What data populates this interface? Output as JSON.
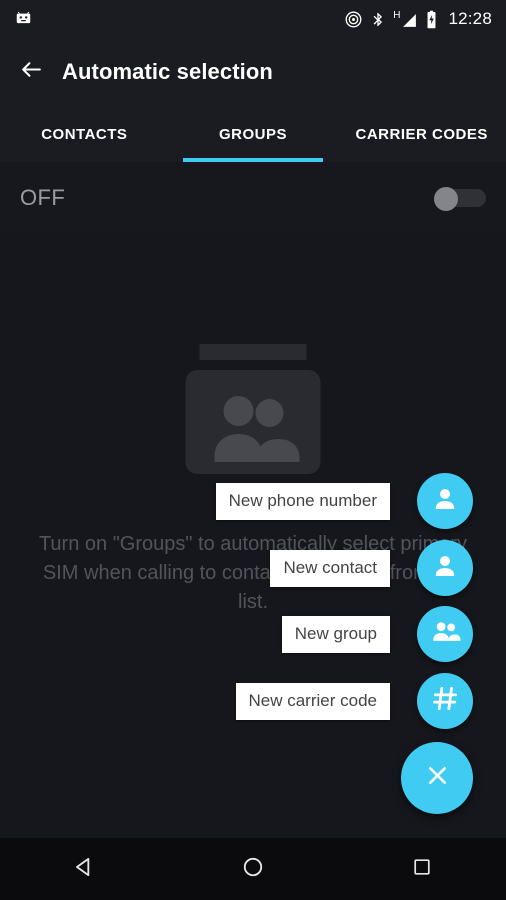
{
  "statusbar": {
    "icons": [
      "android-head-icon",
      "cast-icon",
      "bluetooth-icon",
      "signal-h-icon",
      "battery-charging-icon"
    ],
    "network_type": "H",
    "time": "12:28"
  },
  "appbar": {
    "back_icon": "arrow-back-icon",
    "title": "Automatic selection"
  },
  "tabs": {
    "active_index": 1,
    "accent_color": "#3FCBF2",
    "items": [
      {
        "label": "CONTACTS"
      },
      {
        "label": "GROUPS"
      },
      {
        "label": "CARRIER CODES"
      }
    ]
  },
  "toggle": {
    "label": "OFF",
    "state": "off"
  },
  "empty_state": {
    "icon": "group-placeholder-icon",
    "message": "Turn on \"Groups\" to automatically select primary SIM when calling to contacts in groups from the list."
  },
  "fab_menu": {
    "accent_color": "#3FCBF2",
    "expanded": true,
    "main_icon": "close-icon",
    "items": [
      {
        "label": "New phone number",
        "icon": "person-icon"
      },
      {
        "label": "New contact",
        "icon": "person-icon"
      },
      {
        "label": "New group",
        "icon": "people-icon"
      },
      {
        "label": "New carrier code",
        "icon": "hash-icon"
      }
    ]
  },
  "navbar": {
    "back": "nav-back-icon",
    "home": "nav-home-icon",
    "recents": "nav-recents-icon"
  }
}
